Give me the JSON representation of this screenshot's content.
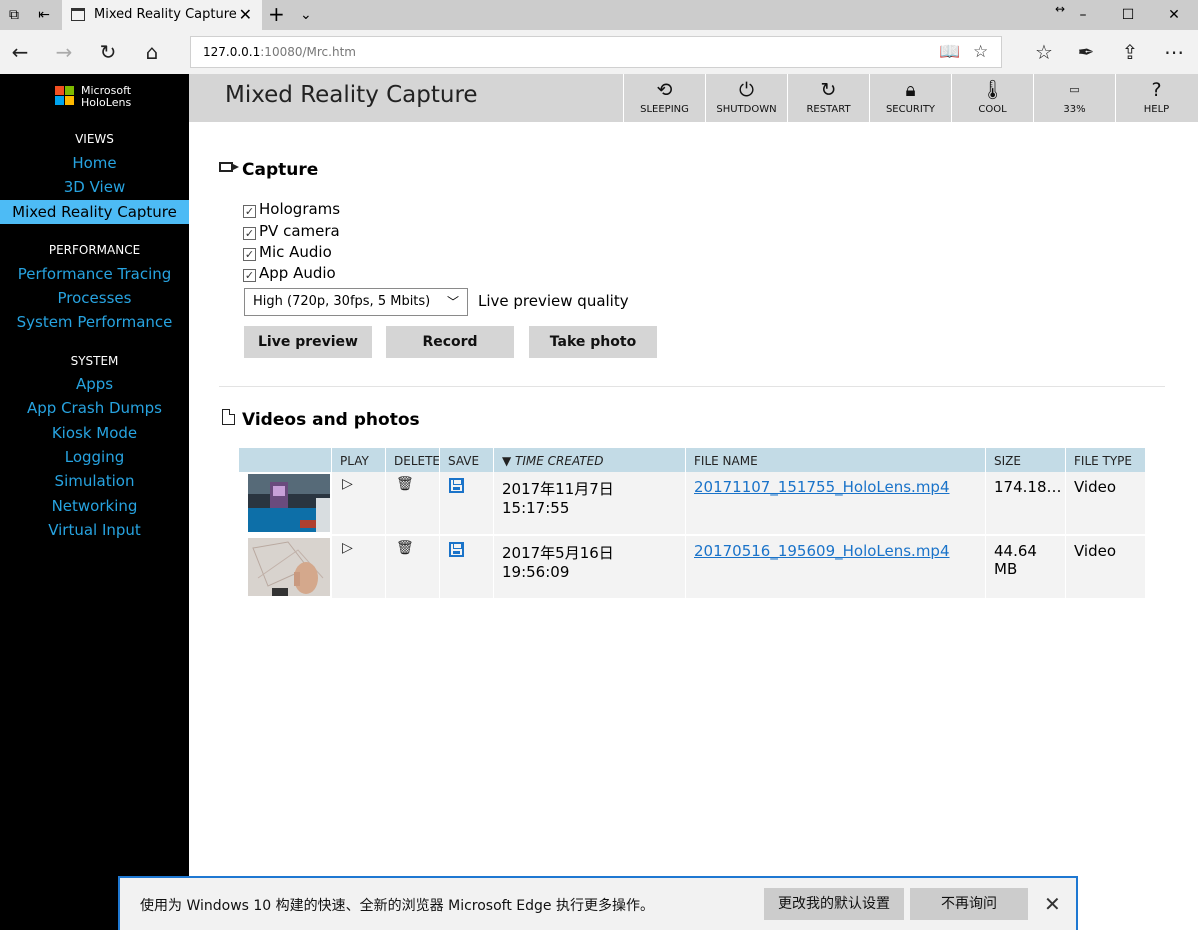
{
  "browser": {
    "tab_title": "Mixed Reality Capture",
    "tab_close": "✕",
    "new_tab": "+",
    "tab_list": "⌄",
    "url_host": "127.0.0.1",
    "url_rest": ":10080/Mrc.htm",
    "window_buttons": [
      "–",
      "☐",
      "✕"
    ]
  },
  "sidebar": {
    "logo_text_1": "Microsoft",
    "logo_text_2": "HoloLens",
    "logo_colors": [
      "#f25022",
      "#7fba00",
      "#00a4ef",
      "#ffb900"
    ],
    "sections": [
      {
        "title": "VIEWS",
        "items": [
          "Home",
          "3D View",
          "Mixed Reality Capture"
        ]
      },
      {
        "title": "PERFORMANCE",
        "items": [
          "Performance Tracing",
          "Processes",
          "System Performance"
        ]
      },
      {
        "title": "SYSTEM",
        "items": [
          "Apps",
          "App Crash Dumps",
          "Kiosk Mode",
          "Logging",
          "Simulation",
          "Networking",
          "Virtual Input"
        ]
      }
    ],
    "active_item": "Mixed Reality Capture"
  },
  "header": {
    "title": "Mixed Reality Capture",
    "buttons": [
      {
        "label": "SLEEPING",
        "icon": "history-icon"
      },
      {
        "label": "SHUTDOWN",
        "icon": "power-icon"
      },
      {
        "label": "RESTART",
        "icon": "restart-icon"
      },
      {
        "label": "SECURITY",
        "icon": "lock-icon"
      },
      {
        "label": "COOL",
        "icon": "thermometer-icon"
      },
      {
        "label": "33%",
        "icon": "battery-icon"
      },
      {
        "label": "HELP",
        "icon": "help-icon"
      }
    ]
  },
  "capture": {
    "title": "Capture",
    "checkboxes": [
      {
        "label": "Holograms",
        "checked": true
      },
      {
        "label": "PV camera",
        "checked": true
      },
      {
        "label": "Mic Audio",
        "checked": true
      },
      {
        "label": "App Audio",
        "checked": true
      }
    ],
    "quality_selected": "High (720p, 30fps, 5 Mbits)",
    "quality_label": "Live preview quality",
    "buttons": {
      "live_preview": "Live preview",
      "record": "Record",
      "take_photo": "Take photo"
    }
  },
  "videos": {
    "title": "Videos and photos",
    "columns": {
      "play": "PLAY",
      "delete": "DELETE",
      "save": "SAVE",
      "time": "TIME CREATED",
      "name": "FILE NAME",
      "size": "SIZE",
      "type": "FILE TYPE"
    },
    "rows": [
      {
        "time": "2017年11月7日 15:17:55",
        "name": "20171107_151755_HoloLens.mp4",
        "size": "174.18…",
        "type": "Video"
      },
      {
        "time": "2017年5月16日 19:56:09",
        "name": "20170516_195609_HoloLens.mp4",
        "size": "44.64 MB",
        "type": "Video"
      }
    ]
  },
  "notification": {
    "text": "使用为 Windows 10 构建的快速、全新的浏览器 Microsoft Edge 执行更多操作。",
    "change_default": "更改我的默认设置",
    "dont_ask": "不再询问",
    "close": "✕"
  }
}
